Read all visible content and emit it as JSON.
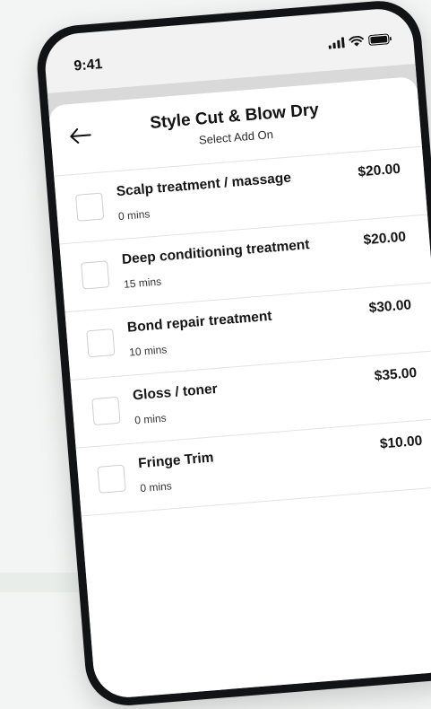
{
  "status_bar": {
    "time": "9:41",
    "icons": [
      "signal-icon",
      "wifi-icon",
      "battery-icon"
    ]
  },
  "header": {
    "back_icon": "arrow-left-icon",
    "title": "Style Cut & Blow Dry",
    "subtitle": "Select Add On"
  },
  "add_ons": [
    {
      "name": "Scalp treatment / massage",
      "duration": "0 mins",
      "price": "$20.00",
      "checked": false
    },
    {
      "name": "Deep conditioning treatment",
      "duration": "15 mins",
      "price": "$20.00",
      "checked": false
    },
    {
      "name": "Bond repair treatment",
      "duration": "10 mins",
      "price": "$30.00",
      "checked": false
    },
    {
      "name": "Gloss / toner",
      "duration": "0 mins",
      "price": "$35.00",
      "checked": false
    },
    {
      "name": "Fringe Trim",
      "duration": "0 mins",
      "price": "$10.00",
      "checked": false
    }
  ],
  "colors": {
    "background": "#f3f5f4",
    "phone_frame": "#111315",
    "sheet": "#ffffff",
    "text": "#151515",
    "divider": "#e3e3e3",
    "checkbox_border": "#cfcfcf"
  }
}
